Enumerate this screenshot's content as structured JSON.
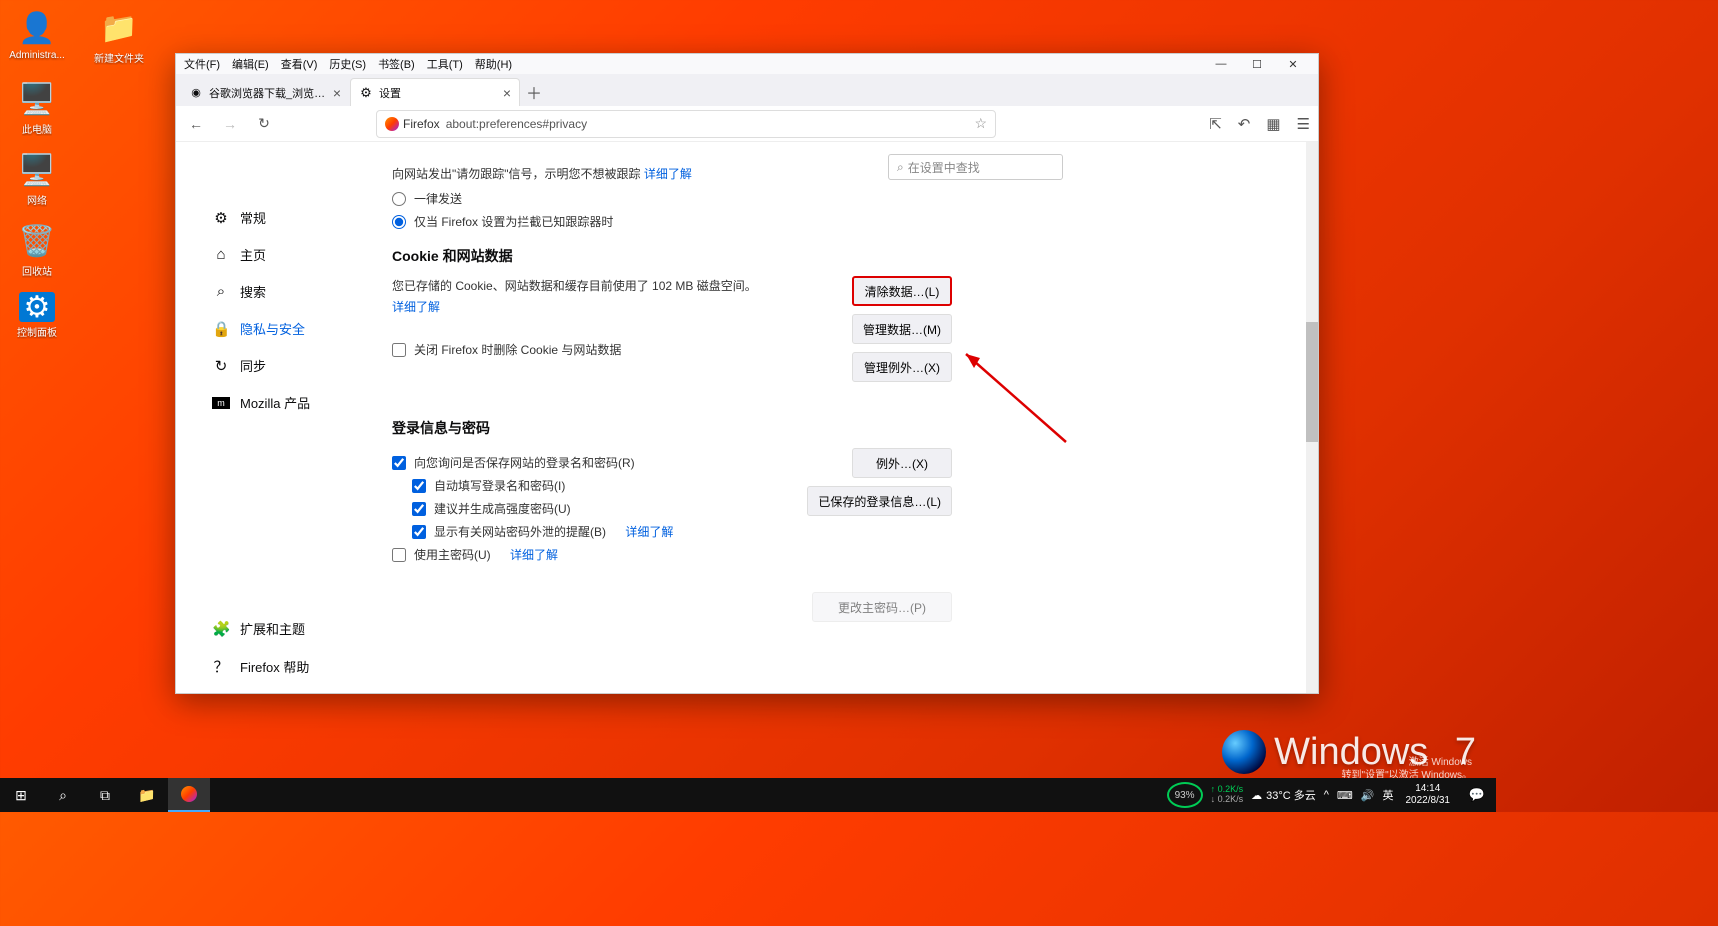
{
  "desktop": {
    "admin": "Administra...",
    "folder": "新建文件夹",
    "pc": "此电脑",
    "network": "网络",
    "recycle": "回收站",
    "cpanel": "控制面板"
  },
  "menubar": [
    "文件(F)",
    "编辑(E)",
    "查看(V)",
    "历史(S)",
    "书签(B)",
    "工具(T)",
    "帮助(H)"
  ],
  "tabs": {
    "t1": "谷歌浏览器下载_浏览器官网入口",
    "t2": "设置"
  },
  "url": {
    "firefox": "Firefox",
    "addr": "about:preferences#privacy"
  },
  "search_placeholder": "在设置中查找",
  "sidebar": {
    "general": "常规",
    "home": "主页",
    "search": "搜索",
    "privacy": "隐私与安全",
    "sync": "同步",
    "mozilla": "Mozilla 产品",
    "ext": "扩展和主题",
    "help": "Firefox 帮助"
  },
  "dnt": {
    "text": "向网站发出\"请勿跟踪\"信号，示明您不想被跟踪",
    "learn": "详细了解",
    "r1": "一律发送",
    "r2": "仅当 Firefox 设置为拦截已知跟踪器时"
  },
  "cookies": {
    "title": "Cookie 和网站数据",
    "desc": "您已存储的 Cookie、网站数据和缓存目前使用了 102 MB 磁盘空间。",
    "learn": "详细了解",
    "clear": "清除数据…(L)",
    "manage": "管理数据…(M)",
    "except": "管理例外…(X)",
    "delclose": "关闭 Firefox 时删除 Cookie 与网站数据"
  },
  "logins": {
    "title": "登录信息与密码",
    "ask": "向您询问是否保存网站的登录名和密码(R)",
    "autofill": "自动填写登录名和密码(I)",
    "suggest": "建议并生成高强度密码(U)",
    "breach": "显示有关网站密码外泄的提醒(B)",
    "learn": "详细了解",
    "master": "使用主密码(U)",
    "learn2": "详细了解",
    "except": "例外…(X)",
    "saved": "已保存的登录信息…(L)",
    "change": "更改主密码…(P)"
  },
  "win": {
    "label": "Windows",
    "seven": "7",
    "activate": "激活 Windows",
    "goto": "转到\"设置\"以激活 Windows。"
  },
  "taskbar": {
    "percent": "93%",
    "netup": "↑ 0.2K/s",
    "netdn": "↓ 0.2K/s",
    "temp": "33°C 多云",
    "ime": "英",
    "time": "14:14",
    "date": "2022/8/31"
  }
}
